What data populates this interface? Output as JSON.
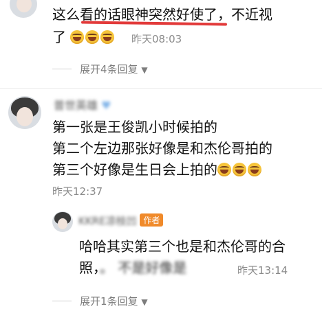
{
  "comment1": {
    "text_line1": "这么看的话眼神突然好使了，不近视",
    "text_line2": "了",
    "emoji_count": 3,
    "time": "昨天08:03",
    "expand": "展开4条回复",
    "highlight_color": "#e23a3a"
  },
  "comment2": {
    "username": "普世英雄",
    "lines": [
      "第一张是王俊凯小时候拍的",
      "第二个左边那张好像是和杰伦哥拍的",
      "第三个好像是生日会上拍的"
    ],
    "emoji_count": 3,
    "time": "昨天12:37"
  },
  "reply": {
    "username": "KKRE凉枝凹",
    "badge": "作者",
    "line1": "哈哈其实第三个也是和杰伦哥的合",
    "line2": "照，",
    "line2_obscured": "。 不是好像是",
    "time": "昨天13:14",
    "expand": "展开1条回复",
    "badge_color": "#f08a2a"
  },
  "icons": {
    "expand_arrow": "▼",
    "heart": "♥"
  }
}
